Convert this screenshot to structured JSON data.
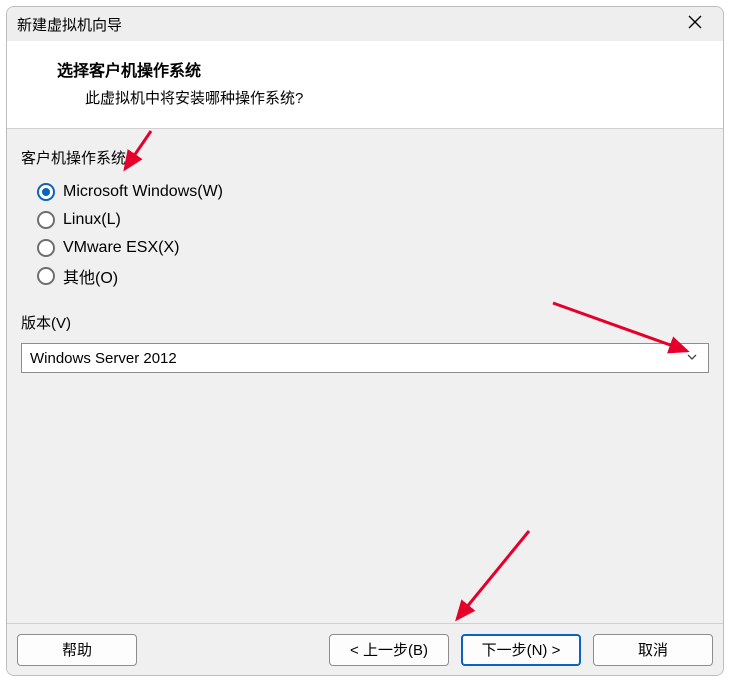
{
  "window": {
    "title": "新建虚拟机向导"
  },
  "header": {
    "title": "选择客户机操作系统",
    "subtitle": "此虚拟机中将安装哪种操作系统?"
  },
  "os_group": {
    "label": "客户机操作系统",
    "options": [
      {
        "label": "Microsoft Windows(W)",
        "selected": true
      },
      {
        "label": "Linux(L)",
        "selected": false
      },
      {
        "label": "VMware ESX(X)",
        "selected": false
      },
      {
        "label": "其他(O)",
        "selected": false
      }
    ]
  },
  "version": {
    "label": "版本(V)",
    "selected": "Windows Server 2012"
  },
  "footer": {
    "help": "帮助",
    "back": "< 上一步(B)",
    "next": "下一步(N) >",
    "cancel": "取消"
  }
}
